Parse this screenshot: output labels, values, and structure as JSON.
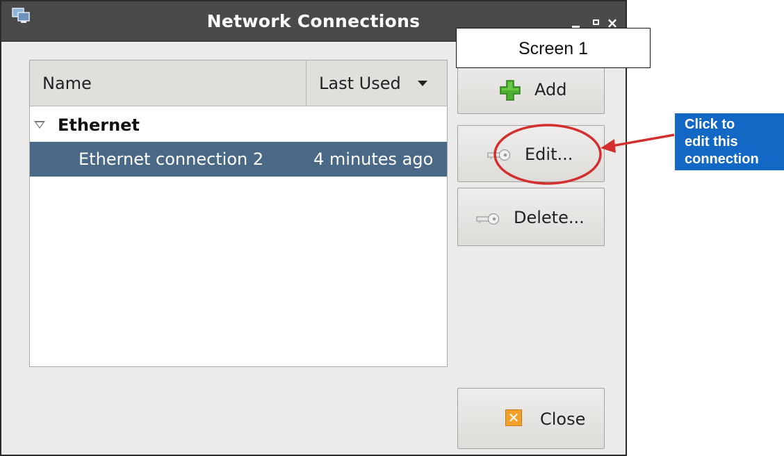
{
  "window": {
    "title": "Network Connections",
    "app_icon": "network-connections-icon",
    "controls": [
      "minimize",
      "maximize",
      "close"
    ]
  },
  "list": {
    "columns": [
      {
        "label": "Name"
      },
      {
        "label": "Last Used",
        "sort": "descending"
      }
    ],
    "groups": [
      {
        "label": "Ethernet",
        "expanded": true,
        "connections": [
          {
            "name": "Ethernet connection 2",
            "last_used": "4 minutes ago",
            "selected": true
          }
        ]
      }
    ]
  },
  "buttons": {
    "add": {
      "label": "Add",
      "icon": "plus-icon"
    },
    "edit": {
      "label": "Edit...",
      "icon": "key-icon"
    },
    "delete": {
      "label": "Delete...",
      "icon": "key-icon"
    },
    "close": {
      "label": "Close",
      "icon": "close-x-icon"
    }
  },
  "annotation": {
    "screen_label": "Screen 1",
    "callout_lines": [
      "Click to",
      "edit this",
      "connection"
    ],
    "highlight_color": "#d32f2f",
    "callout_color": "#1368c6"
  },
  "colors": {
    "selection": "#4a6986",
    "titlebar": "#4a4a4a",
    "window_bg": "#edebe9"
  }
}
